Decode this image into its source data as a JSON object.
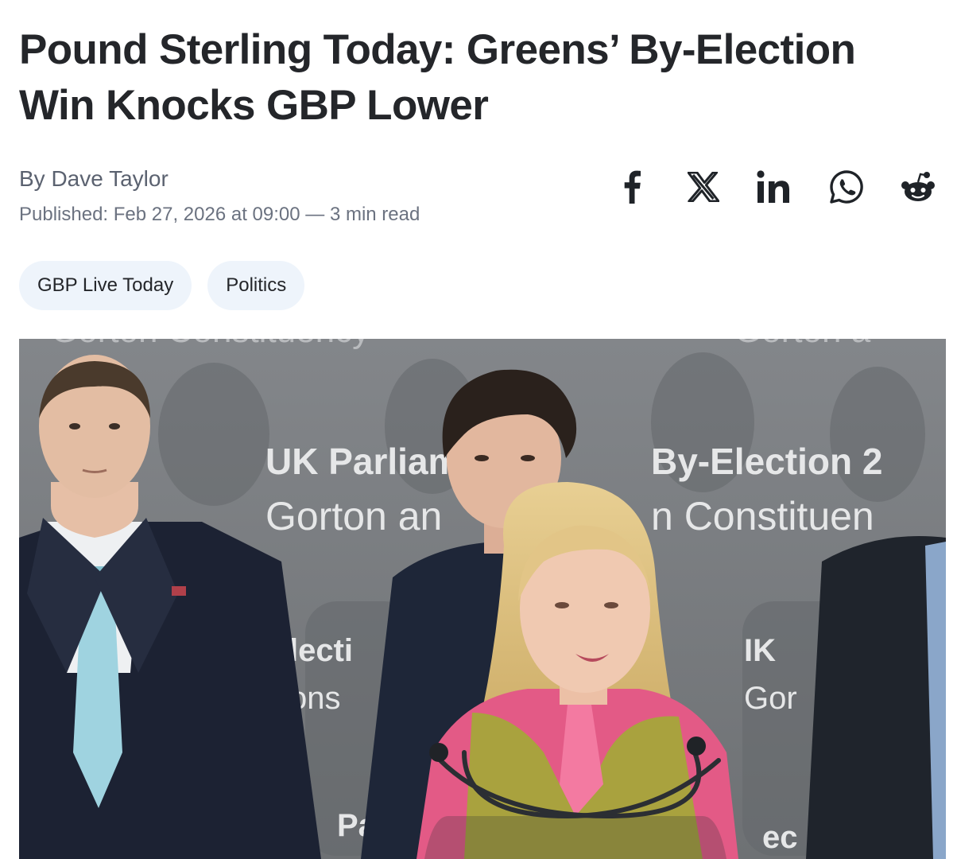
{
  "article": {
    "headline": "Pound Sterling Today: Greens’ By-Election Win Knocks GBP Lower",
    "byline": "By Dave Taylor",
    "published": "Published: Feb 27, 2026 at 09:00 — 3 min read"
  },
  "share": {
    "icons": [
      "facebook-icon",
      "x-icon",
      "linkedin-icon",
      "whatsapp-icon",
      "reddit-icon"
    ]
  },
  "tags": [
    {
      "label": "GBP Live Today"
    },
    {
      "label": "Politics"
    }
  ],
  "hero": {
    "backdrop_line_1": "UK Parliam",
    "backdrop_line_1b": "By-Election 2",
    "backdrop_line_2": "Gorton an",
    "backdrop_line_2b": "n Constituen",
    "backdrop_top_left": "Gorton Constituency",
    "backdrop_top_right": "Gorton a",
    "backdrop_lower_left": "lecti",
    "backdrop_lower_left_2": "ons",
    "backdrop_lower_right": "IK",
    "backdrop_lower_right_2": "Gor",
    "backdrop_bottom_left": "Pa",
    "backdrop_bottom_right": "ec"
  },
  "colors": {
    "headline": "#24262a",
    "meta": "#6b7280",
    "tag_bg": "#eef4fb"
  }
}
